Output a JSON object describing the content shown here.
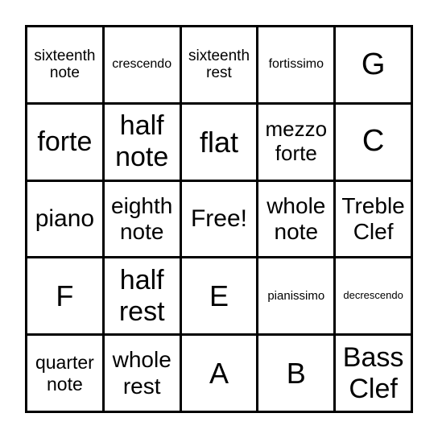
{
  "board": {
    "rows": [
      [
        "sixteenth note",
        "crescendo",
        "sixteenth rest",
        "fortissimo",
        "G"
      ],
      [
        "forte",
        "half note",
        "flat",
        "mezzo forte",
        "C"
      ],
      [
        "piano",
        "eighth note",
        "Free!",
        "whole note",
        "Treble Clef"
      ],
      [
        "F",
        "half rest",
        "E",
        "pianissimo",
        "decrescendo"
      ],
      [
        "quarter note",
        "whole rest",
        "A",
        "B",
        "Bass Clef"
      ]
    ]
  }
}
